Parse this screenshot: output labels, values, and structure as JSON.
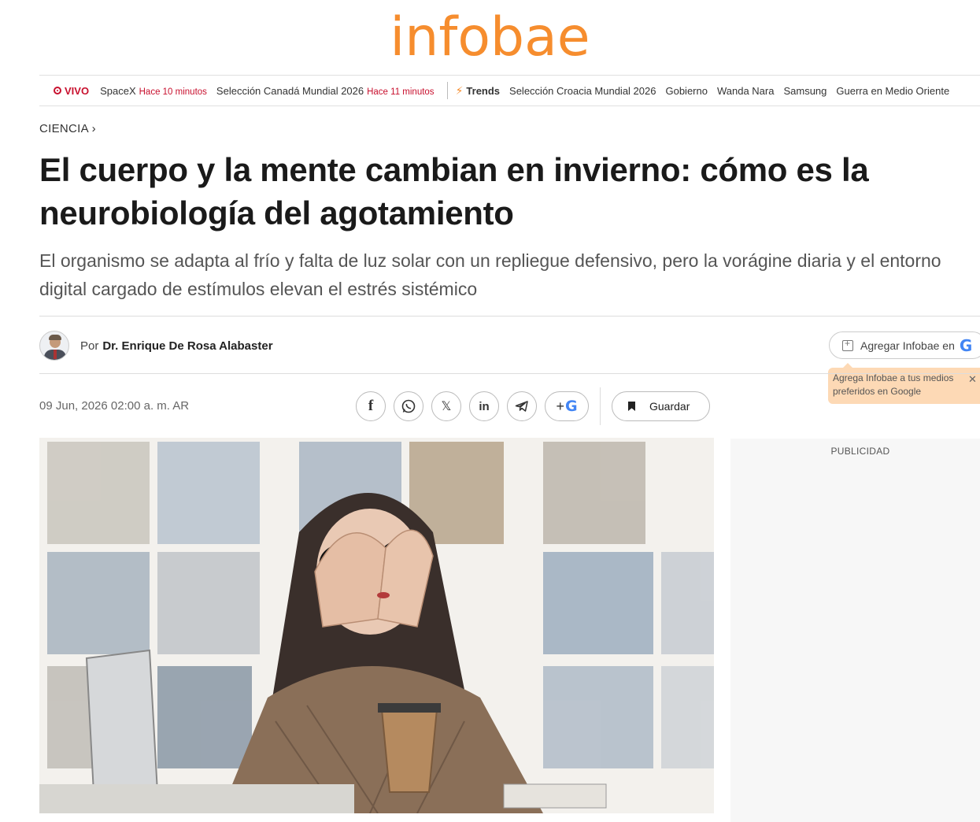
{
  "brand": {
    "logo_text": "infobae",
    "brand_color": "#f68d2e",
    "live_color": "#c8102e"
  },
  "ticker": {
    "live_label": "VIVO",
    "live_items": [
      {
        "label": "SpaceX",
        "time": "Hace 10 minutos"
      },
      {
        "label": "Selección Canadá Mundial 2026",
        "time": "Hace 11 minutos"
      }
    ],
    "trends_label": "Trends",
    "trends": [
      "Selección Croacia Mundial 2026",
      "Gobierno",
      "Wanda Nara",
      "Samsung",
      "Guerra en Medio Oriente"
    ]
  },
  "article": {
    "section": "CIENCIA",
    "title": "El cuerpo y la mente cambian en invierno: cómo es la neurobiología del agotamiento",
    "subtitle": "El organismo se adapta al frío y falta de luz solar con un repliegue defensivo, pero la vorágine diaria y el entorno digital cargado de estímulos elevan el estrés sistémico",
    "author_prefix": "Por",
    "author_name": "Dr. Enrique De Rosa Alabaster",
    "date": "09 Jun, 2026 02:00 a. m. AR"
  },
  "google_follow": {
    "button_label": "Agregar Infobae en",
    "g_glyph": "G",
    "tooltip": "Agrega Infobae a tus medios preferidos en Google",
    "close_glyph": "✕"
  },
  "share": {
    "icons": [
      "facebook-icon",
      "whatsapp-icon",
      "x-icon",
      "linkedin-icon",
      "telegram-icon",
      "google-add-icon"
    ],
    "facebook_glyph": "f",
    "x_glyph": "𝕏",
    "linkedin_glyph": "in",
    "plus_glyph": "+",
    "g_glyph": "G",
    "save_label": "Guardar"
  },
  "ad": {
    "label": "PUBLICIDAD"
  }
}
